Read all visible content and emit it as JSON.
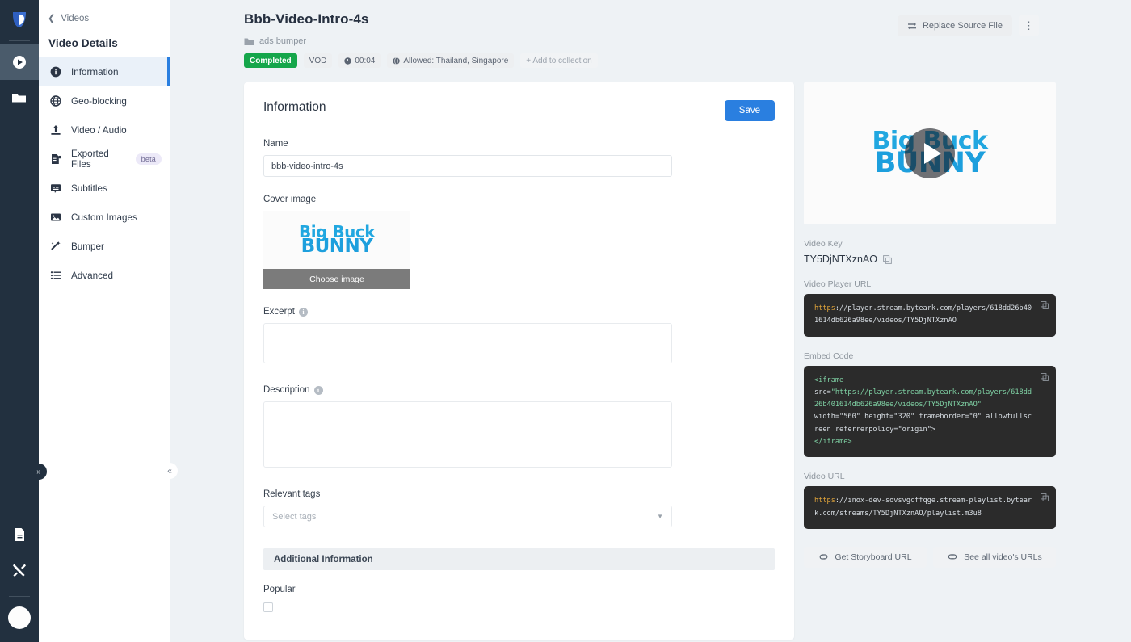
{
  "rail": {
    "logo_icon": "byteark-logo-icon",
    "items": [
      {
        "icon": "play-circle-icon",
        "name": "videos",
        "active": true
      },
      {
        "icon": "folder-icon",
        "name": "projects",
        "active": false
      }
    ],
    "bottom_items": [
      {
        "icon": "document-icon",
        "name": "docs"
      },
      {
        "icon": "tools-icon",
        "name": "tools"
      }
    ],
    "avatar_label": "",
    "expand_icon": "»"
  },
  "sidebar": {
    "back_label": "Videos",
    "back_icon": "chevron-left-icon",
    "title": "Video Details",
    "collapse_icon": "«",
    "items": [
      {
        "label": "Information",
        "icon": "info-icon",
        "active": true,
        "badge": ""
      },
      {
        "label": "Geo-blocking",
        "icon": "globe-icon",
        "active": false,
        "badge": ""
      },
      {
        "label": "Video / Audio",
        "icon": "upload-icon",
        "active": false,
        "badge": ""
      },
      {
        "label": "Exported Files",
        "icon": "file-export-icon",
        "active": false,
        "badge": "beta"
      },
      {
        "label": "Subtitles",
        "icon": "subtitles-icon",
        "active": false,
        "badge": ""
      },
      {
        "label": "Custom Images",
        "icon": "image-icon",
        "active": false,
        "badge": ""
      },
      {
        "label": "Bumper",
        "icon": "wand-icon",
        "active": false,
        "badge": ""
      },
      {
        "label": "Advanced",
        "icon": "list-icon",
        "active": false,
        "badge": ""
      }
    ]
  },
  "header": {
    "title": "Bbb-Video-Intro-4s",
    "folder_icon": "folder-icon",
    "folder": "ads bumper",
    "chips": [
      {
        "label": "Completed",
        "type": "status"
      },
      {
        "label": "VOD",
        "type": "plain"
      },
      {
        "label": "00:04",
        "type": "plain",
        "icon": "clock-icon"
      },
      {
        "label": "Allowed: Thailand, Singapore",
        "type": "plain",
        "icon": "globe-small-icon"
      },
      {
        "label": "+ Add to collection",
        "type": "ghost"
      }
    ],
    "replace_button": "Replace Source File",
    "replace_icon": "swap-icon",
    "kebab_icon": "⋮"
  },
  "info_card": {
    "title": "Information",
    "save_label": "Save",
    "name_label": "Name",
    "name_value": "bbb-video-intro-4s",
    "cover_label": "Cover image",
    "cover_logo_line1": "Big Buck",
    "cover_logo_line2": "BUNNY",
    "choose_image_label": "Choose image",
    "excerpt_label": "Excerpt",
    "excerpt_value": "",
    "description_label": "Description",
    "description_value": "",
    "tags_label": "Relevant tags",
    "tags_placeholder": "Select tags",
    "additional_section_title": "Additional Information",
    "popular_label": "Popular",
    "popular_checked": false
  },
  "right_panel": {
    "player_logo_line1": "Big Buck",
    "player_logo_line2": "BUNNY",
    "play_icon": "play-icon",
    "video_key_label": "Video Key",
    "video_key": "TY5DjNTXznAO",
    "copy_icon": "copy-icon",
    "player_url_label": "Video Player URL",
    "player_url_scheme": "https",
    "player_url_rest": "://player.stream.byteark.com/players/618dd26b401614db626a98ee/videos/TY5DjNTXznAO",
    "embed_label": "Embed Code",
    "embed_open_tag": "<iframe",
    "embed_src_attr": "src=",
    "embed_src_value": "\"https://player.stream.byteark.com/players/618dd26b401614db626a98ee/videos/TY5DjNTXznAO\"",
    "embed_attrs": "width=\"560\" height=\"320\" frameborder=\"0\" allowfullscreen referrerpolicy=\"origin\">",
    "embed_close_tag": "</iframe>",
    "video_url_label": "Video URL",
    "video_url_scheme": "https",
    "video_url_rest": "://inox-dev-sovsvgcffqge.stream-playlist.byteark.com/streams/TY5DjNTXznAO/playlist.m3u8",
    "storyboard_button": "Get Storyboard URL",
    "storyboard_icon": "link-icon",
    "all_urls_button": "See all video's URLs",
    "all_urls_icon": "link-chain-icon"
  },
  "colors": {
    "accent": "#2a7fe0",
    "rail_bg": "#22303f",
    "page_bg": "#eef2f5",
    "status_green": "#15a64b",
    "code_bg": "#2b2b2b"
  }
}
